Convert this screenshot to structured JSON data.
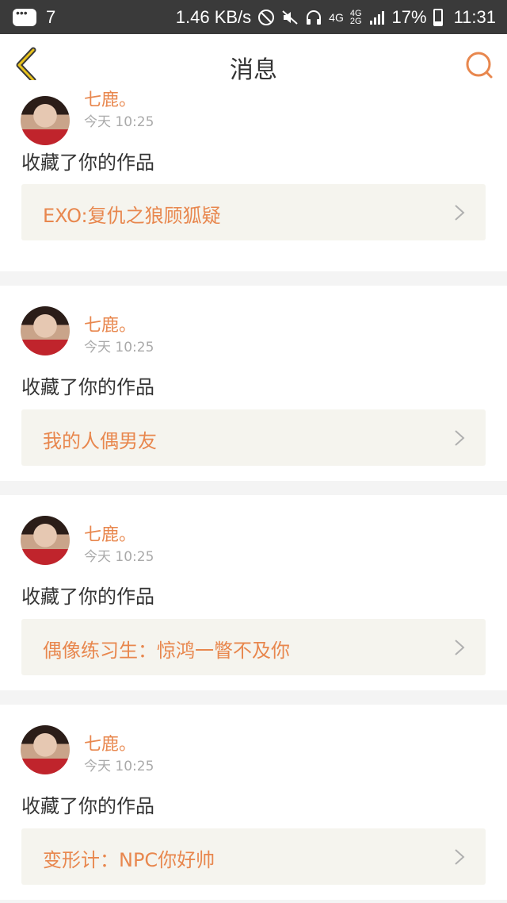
{
  "status_bar": {
    "notification_count": "7",
    "speed": "1.46 KB/s",
    "network_top": "4G",
    "network_small_top": "4G",
    "network_small_bottom": "2G",
    "battery": "17%",
    "time": "11:31",
    "icons": [
      "message-icon",
      "block-icon",
      "mute-icon",
      "headphone-icon",
      "signal-icon",
      "battery-icon"
    ]
  },
  "header": {
    "title": "消息",
    "back_icon": "chevron-left-icon",
    "search_icon": "search-icon",
    "accent": "#e8874e"
  },
  "messages": [
    {
      "user": "七鹿。",
      "time": "今天 10:25",
      "action": "收藏了你的作品",
      "work": "EXO:复仇之狼顾狐疑"
    },
    {
      "user": "七鹿。",
      "time": "今天 10:25",
      "action": "收藏了你的作品",
      "work": "我的人偶男友"
    },
    {
      "user": "七鹿。",
      "time": "今天 10:25",
      "action": "收藏了你的作品",
      "work": "偶像练习生：惊鸿一瞥不及你"
    },
    {
      "user": "七鹿。",
      "time": "今天 10:25",
      "action": "收藏了你的作品",
      "work": "变形计：NPC你好帅"
    }
  ]
}
